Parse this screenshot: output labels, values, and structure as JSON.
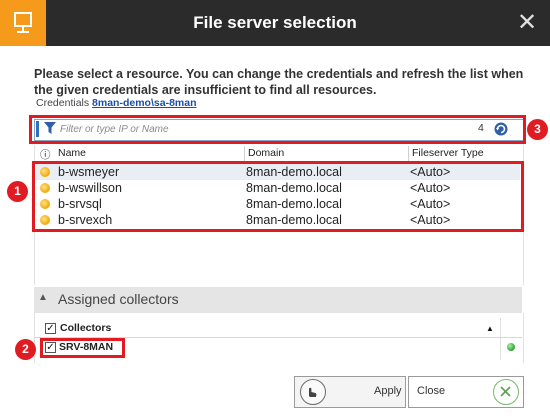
{
  "window": {
    "title": "File server selection",
    "close_glyph": "✕",
    "app_icon": "monitor-icon",
    "accent": "#f59a1b"
  },
  "intro": {
    "text": "Please select a resource. You can change the credentials and refresh the list when the given credentials are insufficient to find all resources.",
    "credentials_label": "Credentials",
    "credentials_value": "8man-demo\\sa-8man"
  },
  "search": {
    "placeholder": "Filter or type IP or Name",
    "count": "4"
  },
  "table": {
    "info_glyph": "ⓘ",
    "columns": [
      "Name",
      "Domain",
      "Fileserver Type"
    ],
    "rows": [
      {
        "name": "b-wsmeyer",
        "domain": "8man-demo.local",
        "type": "<Auto>"
      },
      {
        "name": "b-wswillson",
        "domain": "8man-demo.local",
        "type": "<Auto>"
      },
      {
        "name": "b-srvsql",
        "domain": "8man-demo.local",
        "type": "<Auto>"
      },
      {
        "name": "b-srvexch",
        "domain": "8man-demo.local",
        "type": "<Auto>"
      }
    ]
  },
  "collectors": {
    "section_title": "Assigned collectors",
    "header": "Collectors",
    "items": [
      {
        "name": "SRV-8MAN",
        "checked": true,
        "status": "online",
        "status_color": "#3cb043"
      }
    ]
  },
  "buttons": {
    "apply": "Apply",
    "close": "Close"
  },
  "callouts": [
    "1",
    "2",
    "3"
  ]
}
